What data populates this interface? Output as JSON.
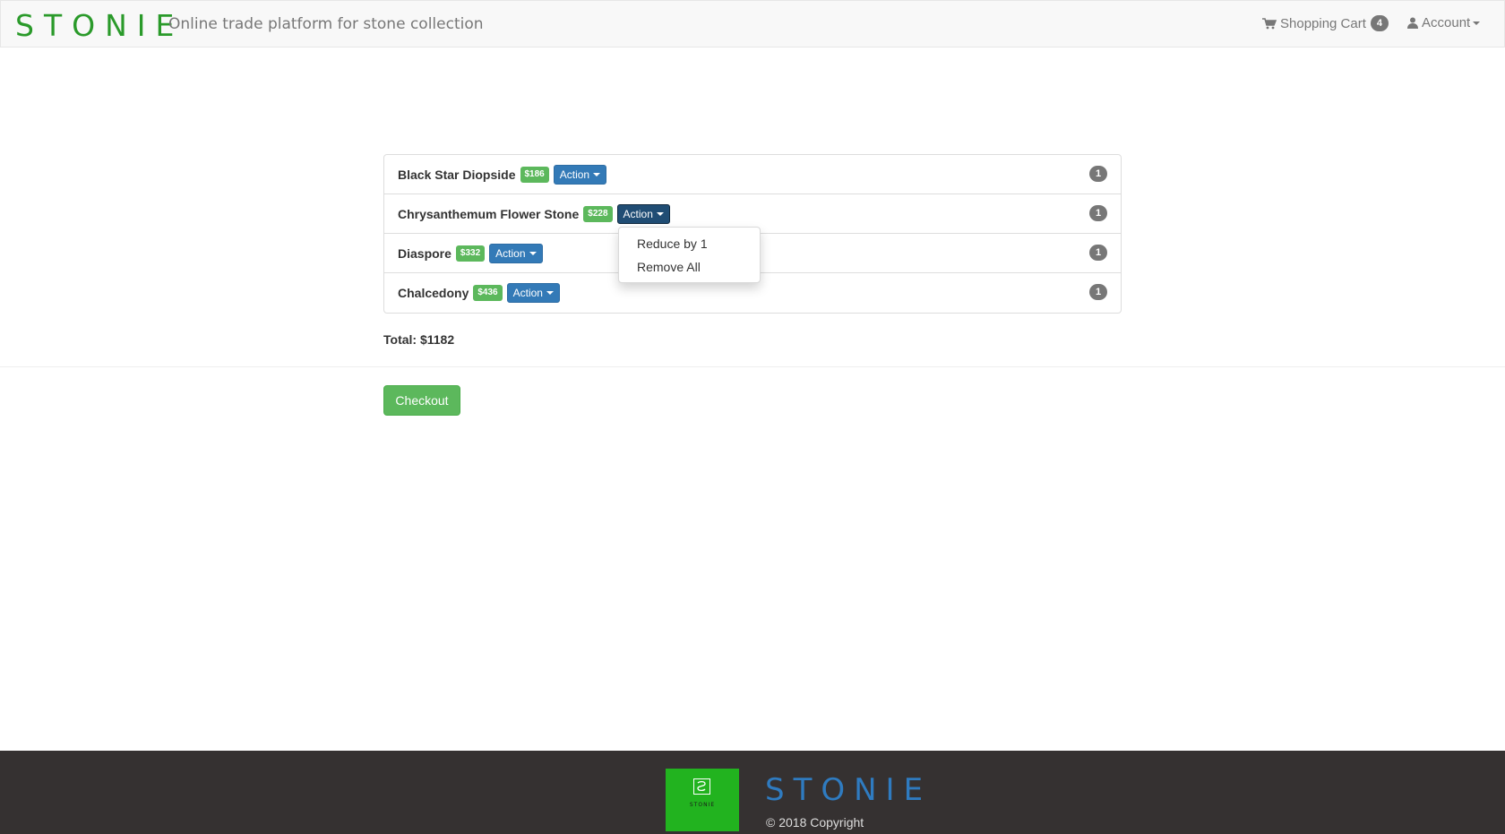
{
  "navbar": {
    "brand": "STONIE",
    "tagline": "Online trade platform for stone collection",
    "cart_label": "Shopping Cart",
    "cart_count": "4",
    "account_label": "Account"
  },
  "cart": {
    "items": [
      {
        "name": "Black Star Diopside",
        "price": "$186",
        "action": "Action",
        "quantity": "1"
      },
      {
        "name": "Chrysanthemum Flower Stone",
        "price": "$228",
        "action": "Action",
        "quantity": "1"
      },
      {
        "name": "Diaspore",
        "price": "$332",
        "action": "Action",
        "quantity": "1"
      },
      {
        "name": "Chalcedony",
        "price": "$436",
        "action": "Action",
        "quantity": "1"
      }
    ],
    "dropdown": {
      "open_for_item": "Chrysanthemum Flower Stone",
      "options": [
        "Reduce by 1",
        "Remove All"
      ]
    },
    "total": "Total: $1182",
    "checkout_label": "Checkout"
  },
  "footer": {
    "logo_text": "STONIE",
    "brand": "STONIE",
    "copyright": "© 2018 Copyright"
  },
  "colors": {
    "brand_green": "#2a9a2a",
    "price_green": "#5cb85c",
    "action_blue": "#337ab7",
    "footer_bg": "#353131",
    "footer_brand_blue": "#2f7bc0"
  },
  "icons": {
    "cart": "shopping-cart-icon",
    "account": "user-icon"
  }
}
